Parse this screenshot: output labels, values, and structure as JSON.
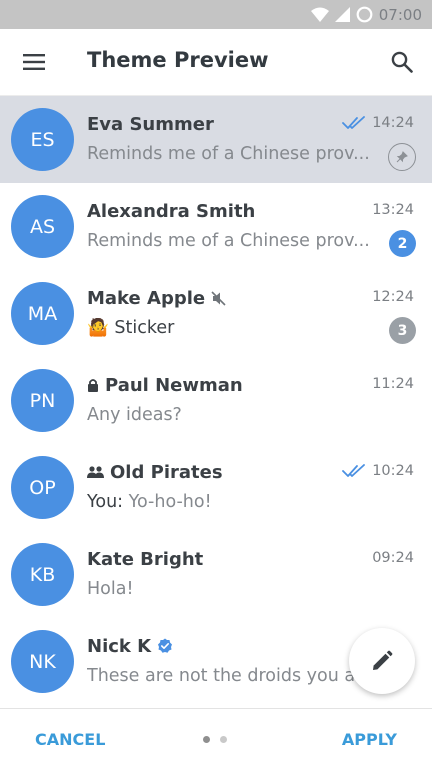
{
  "status_bar": {
    "time": "07:00",
    "icons": [
      "wifi-icon",
      "signal-icon",
      "data-saver-icon"
    ]
  },
  "app_bar": {
    "title": "Theme Preview",
    "menu_icon": "menu-icon",
    "search_icon": "search-icon"
  },
  "chats": [
    {
      "initials": "ES",
      "name": "Eva Summer",
      "message": "Reminds me of a Chinese prov...",
      "time": "14:24",
      "read_ticks": true,
      "pinned": true,
      "selected": true
    },
    {
      "initials": "AS",
      "name": "Alexandra Smith",
      "message": "Reminds me of a Chinese prov...",
      "time": "13:24",
      "unread": "2",
      "badge": "blue"
    },
    {
      "initials": "MA",
      "name": "Make Apple",
      "muted": true,
      "message_emoji": "🤷",
      "message": "Sticker",
      "time": "12:24",
      "unread": "3",
      "badge": "gray"
    },
    {
      "initials": "PN",
      "name": "Paul Newman",
      "locked": true,
      "message": "Any ideas?",
      "time": "11:24"
    },
    {
      "initials": "OP",
      "name": "Old Pirates",
      "group": true,
      "sender": "You:",
      "message": "Yo-ho-ho!",
      "time": "10:24",
      "read_ticks": true
    },
    {
      "initials": "KB",
      "name": "Kate Bright",
      "message": "Hola!",
      "time": "09:24"
    },
    {
      "initials": "NK",
      "name": "Nick K",
      "verified": true,
      "message": "These are not the droids you are looking for",
      "time": ""
    }
  ],
  "fab": {
    "icon": "pencil-icon"
  },
  "bottom": {
    "cancel": "CANCEL",
    "apply": "APPLY",
    "pages": 2,
    "current_page": 1
  },
  "colors": {
    "accent": "#4a90e2",
    "button_text": "#3a9bd9",
    "selected_row": "#d9dce3",
    "status_bar": "#c4c4c4"
  }
}
